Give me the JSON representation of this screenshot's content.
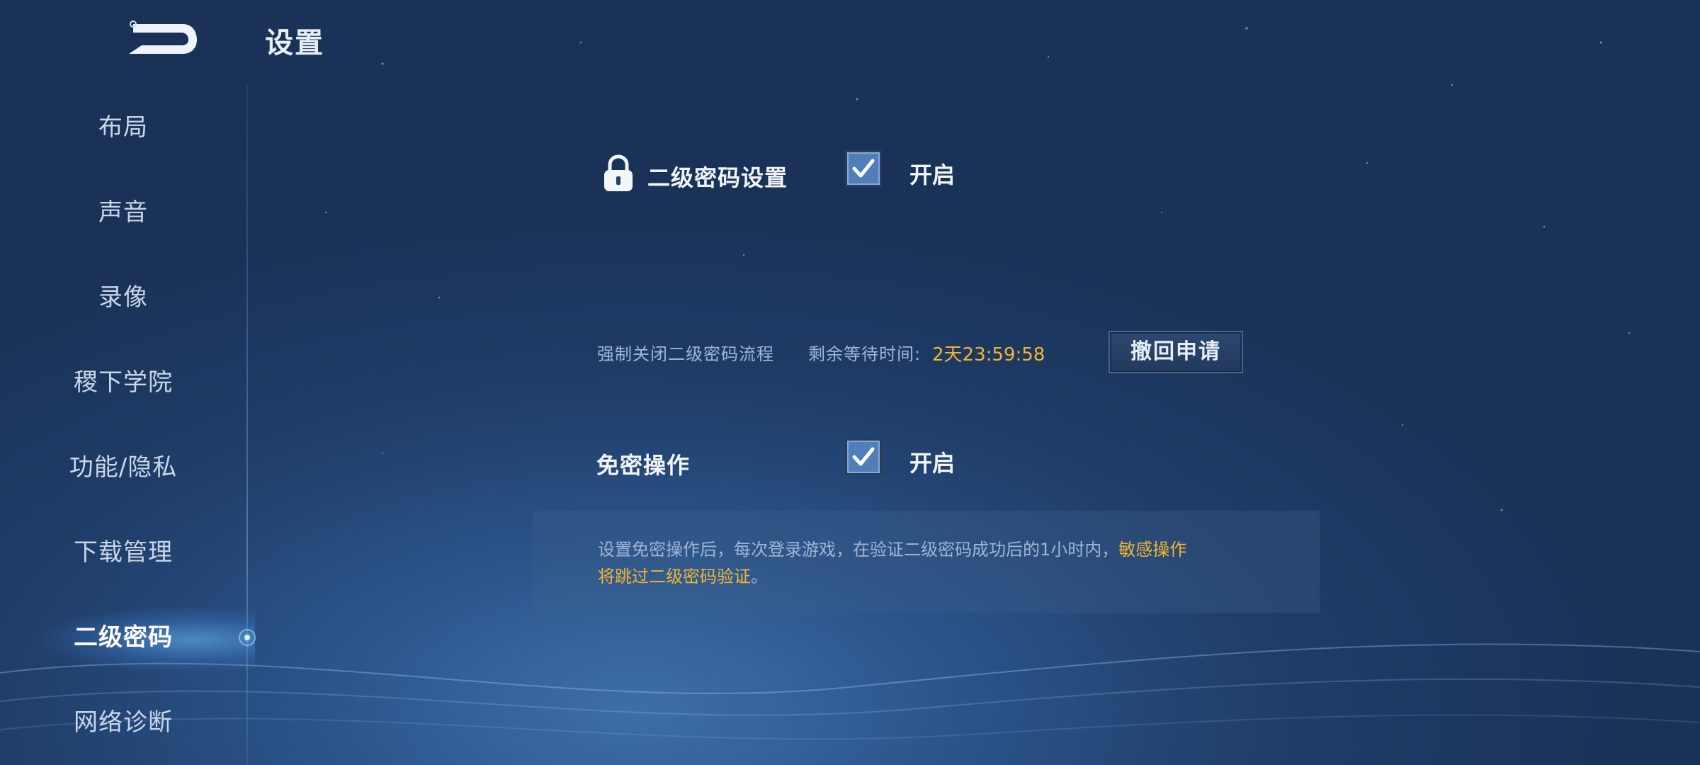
{
  "header": {
    "back_icon": "back-arrow-icon",
    "title": "设置"
  },
  "sidebar": {
    "items": [
      {
        "label": "布局",
        "active": false
      },
      {
        "label": "声音",
        "active": false
      },
      {
        "label": "录像",
        "active": false
      },
      {
        "label": "稷下学院",
        "active": false
      },
      {
        "label": "功能/隐私",
        "active": false
      },
      {
        "label": "下载管理",
        "active": false
      },
      {
        "label": "二级密码",
        "active": true
      },
      {
        "label": "网络诊断",
        "active": false
      }
    ]
  },
  "second_password": {
    "icon": "lock-icon",
    "label": "二级密码设置",
    "checked": true,
    "toggle_label": "开启"
  },
  "force_close": {
    "text": "强制关闭二级密码流程",
    "wait_label": "剩余等待时间:",
    "wait_time": "2天23:59:58",
    "withdraw_button": "撤回申请"
  },
  "password_free": {
    "label": "免密操作",
    "checked": true,
    "toggle_label": "开启"
  },
  "info": {
    "text_plain": "设置免密操作后，每次登录游戏，在验证二级密码成功后的1小时内，",
    "text_highlight_1": "敏感操作",
    "text_highlight_2": "将跳过二级密码验证",
    "text_end": "。"
  },
  "colors": {
    "accent_gold": "#f0b633",
    "muted_text": "#9fb6d6",
    "checkbox_fill": "#4f7fb8"
  }
}
